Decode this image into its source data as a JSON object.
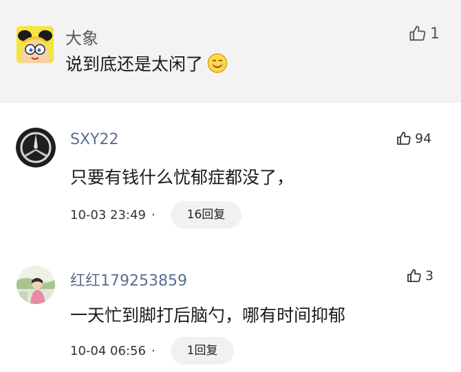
{
  "comments": [
    {
      "name": "大象",
      "text": "说到底还是太闲了",
      "likes": "1",
      "avatar_icon": "cartoon-girl-avatar",
      "emoji": "smiling-face-emoji"
    },
    {
      "name": "SXY22",
      "text": "只要有钱什么忧郁症都没了，",
      "likes": "94",
      "time": "10-03 23:49",
      "dot": "·",
      "replies": "16回复",
      "avatar_icon": "mercedes-logo-avatar"
    },
    {
      "name": "红红179253859",
      "text": "一天忙到脚打后脑勺，哪有时间抑郁",
      "likes": "3",
      "time": "10-04 06:56",
      "dot": "·",
      "replies": "1回复",
      "avatar_icon": "photo-avatar"
    }
  ],
  "colors": {
    "top_bg": "#f3f3f3",
    "name": "#5a6e8f",
    "text": "#1a1a1a",
    "pill": "#f1f1f1"
  }
}
